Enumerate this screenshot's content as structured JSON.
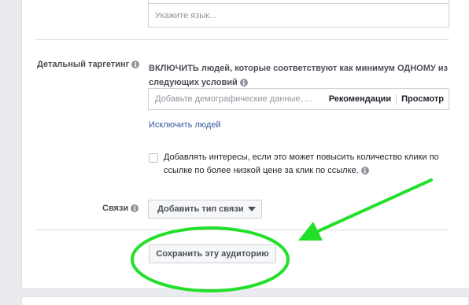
{
  "language": {
    "placeholder": "Укажите язык..."
  },
  "detailed_targeting": {
    "label": "Детальный таргетинг",
    "heading": "ВКЛЮЧИТЬ людей, которые соответствуют как минимум ОДНОМУ из следующих условий",
    "search_placeholder": "Добавьте демографические данные, ...",
    "recommendations_label": "Рекомендации",
    "browse_label": "Просмотр",
    "exclude_label": "Исключить людей",
    "expand_interests_text": "Добавлять интересы, если это может повысить количество клики по ссылке по более низкой цене за клик по ссылке."
  },
  "connections": {
    "label": "Связи",
    "add_button": "Добавить тип связи"
  },
  "save_audience": {
    "button": "Сохранить эту аудиторию"
  },
  "annotation": {
    "color": "#22e02a"
  }
}
